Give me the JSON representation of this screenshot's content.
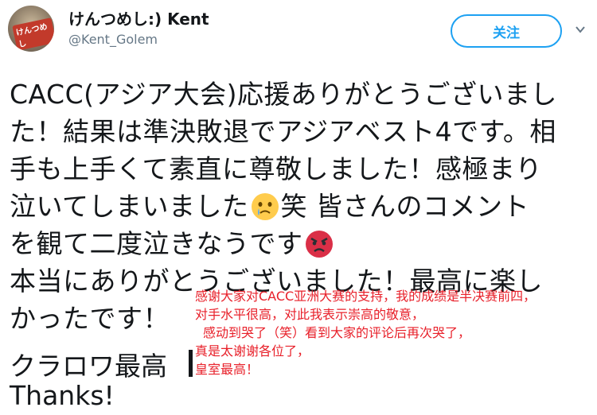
{
  "user": {
    "display_name": "けんつめし:) Kent",
    "handle": "@Kent_Golem",
    "avatar_text": "けんつめし"
  },
  "follow_button": {
    "label": "关注"
  },
  "tweet": {
    "lines": [
      "CACC(アジア大会)応援ありがとうございまし",
      "た！結果は準決敗退でアジアベスト4です。相",
      "手も上手くて素直に尊敬しました！感極まり",
      "泣いてしまいました",
      "笑 皆さんのコメント",
      "を観て二度泣きなうです",
      "本当にありがとうございました！最高に楽し",
      "かったです！"
    ],
    "kuraro": "クラロワ最高",
    "thanks": "Thanks!"
  },
  "translation": {
    "lines": [
      "感谢大家对CACC亚洲大赛的支持，我的成绩是半决赛前四，",
      "对手水平很高，对此我表示崇高的敬意，",
      "感动到哭了（笑）看到大家的评论后再次哭了，",
      "真是太谢谢各位了，",
      "皇室最高！"
    ]
  },
  "colors": {
    "accent": "#1da1f2",
    "text": "#14171a",
    "muted": "#657786",
    "translation": "#e8202a"
  },
  "icons": {
    "crying_emoji": "crying-face-icon",
    "angry_emoji": "angry-face-icon",
    "menu_chevron": "chevron-down-icon"
  }
}
